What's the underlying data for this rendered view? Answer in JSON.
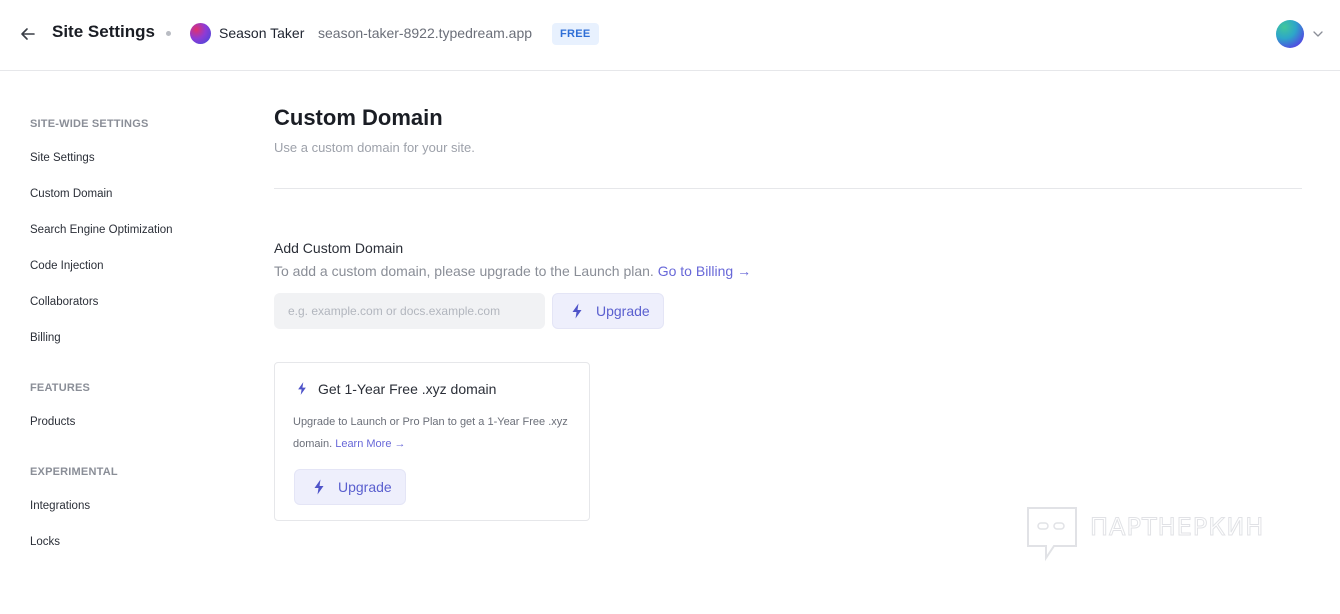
{
  "header": {
    "title": "Site Settings",
    "site_name": "Season Taker",
    "site_url": "season-taker-8922.typedream.app",
    "plan_badge": "FREE"
  },
  "sidebar": {
    "sections": [
      {
        "label": "SITE-WIDE SETTINGS",
        "items": [
          "Site Settings",
          "Custom Domain",
          "Search Engine Optimization",
          "Code Injection",
          "Collaborators",
          "Billing"
        ]
      },
      {
        "label": "FEATURES",
        "items": [
          "Products"
        ]
      },
      {
        "label": "EXPERIMENTAL",
        "items": [
          "Integrations",
          "Locks"
        ]
      }
    ]
  },
  "main": {
    "title": "Custom Domain",
    "subtitle": "Use a custom domain for your site.",
    "add_domain": {
      "title": "Add Custom Domain",
      "description": "To add a custom domain, please upgrade to the Launch plan.",
      "billing_link": "Go to Billing →",
      "input_placeholder": "e.g. example.com or docs.example.com",
      "upgrade_label": "Upgrade"
    },
    "promo_card": {
      "title": "Get 1-Year Free .xyz domain",
      "text": "Upgrade to Launch or Pro Plan to get a 1-Year Free .xyz domain.",
      "learn_more": "Learn More →",
      "upgrade_label": "Upgrade"
    }
  },
  "watermark": {
    "text": "ПАРТНЕРКИН"
  },
  "colors": {
    "accent": "#5a5fcf",
    "badge_bg": "#e8f1fe",
    "badge_text": "#2f6fd6"
  }
}
